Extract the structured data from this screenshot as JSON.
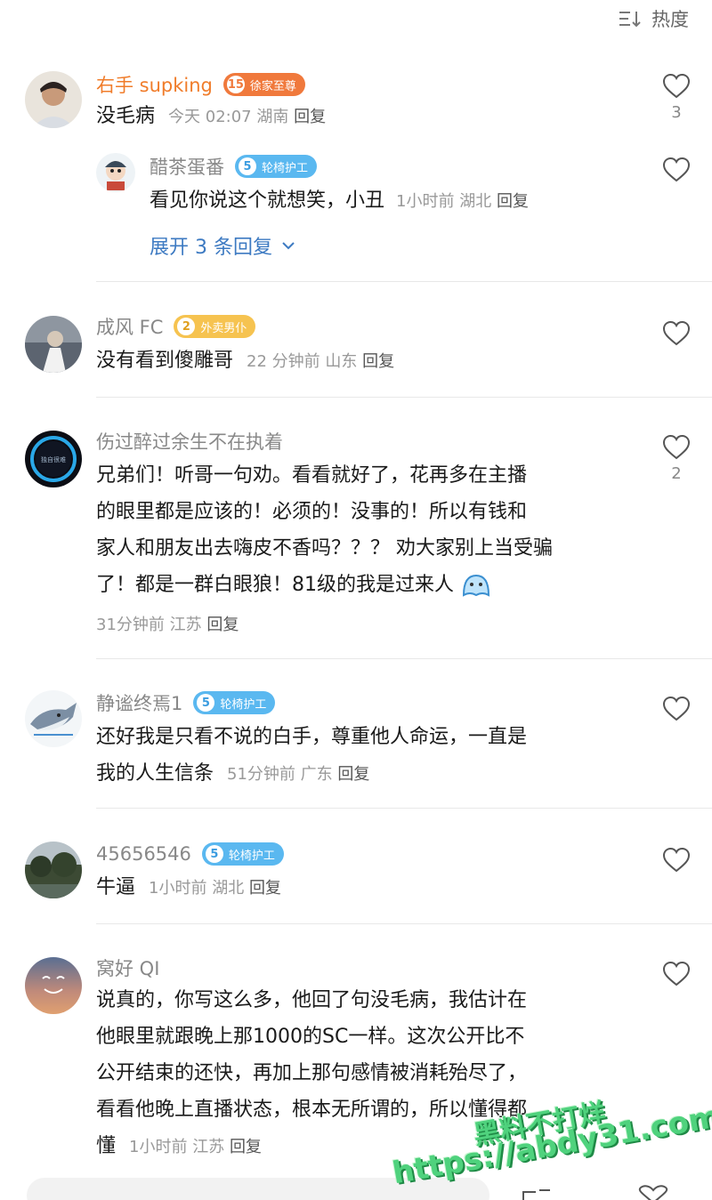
{
  "sort": {
    "label": "热度"
  },
  "comments": [
    {
      "name": "右手 supking",
      "badge_level": "15",
      "badge_text": "徐家至尊",
      "text": "没毛病",
      "time": "今天 02:07",
      "location": "湖南",
      "reply": "回复",
      "likes": "3",
      "sub": {
        "name": "醋茶蛋番",
        "badge_level": "5",
        "badge_text": "轮椅护工",
        "text": "看见你说这个就想笑，小丑",
        "time": "1小时前",
        "location": "湖北",
        "reply": "回复"
      },
      "expand": "展开 3 条回复"
    },
    {
      "name": "成风 FC",
      "badge_level": "2",
      "badge_text": "外卖男仆",
      "text": "没有看到傻雕哥",
      "time": "22 分钟前",
      "location": "山东",
      "reply": "回复"
    },
    {
      "name": "伤过醉过余生不在执着",
      "avatar_text": "独自很难",
      "lines": [
        "兄弟们！听哥一句劝。看看就好了，花再多在主播",
        "的眼里都是应该的！必须的！没事的！所以有钱和",
        "家人和朋友出去嗨皮不香吗？？？ 劝大家别上当受骗",
        "了！都是一群白眼狼！81级的我是过来人"
      ],
      "time": "31分钟前",
      "location": "江苏",
      "reply": "回复",
      "likes": "2"
    },
    {
      "name": "静谧终焉1",
      "badge_level": "5",
      "badge_text": "轮椅护工",
      "lines": [
        "还好我是只看不说的白手，尊重他人命运，一直是",
        "我的人生信条"
      ],
      "time": "51分钟前",
      "location": "广东",
      "reply": "回复"
    },
    {
      "name": "45656546",
      "badge_level": "5",
      "badge_text": "轮椅护工",
      "text": "牛逼",
      "time": "1小时前",
      "location": "湖北",
      "reply": "回复"
    },
    {
      "name": "窝好 QI",
      "lines": [
        "说真的，你写这么多，他回了句没毛病，我估计在",
        "他眼里就跟晚上那1000的SC一样。这次公开比不",
        "公开结束的还快，再加上那句感情被消耗殆尽了，",
        "看看他晚上直播状态，根本无所谓的，所以懂得都"
      ],
      "last_line": "懂",
      "time": "1小时前",
      "location": "江苏",
      "reply": "回复"
    }
  ],
  "watermark": {
    "line1": "黑料不打烊",
    "line2": "https://abdy31.com"
  }
}
